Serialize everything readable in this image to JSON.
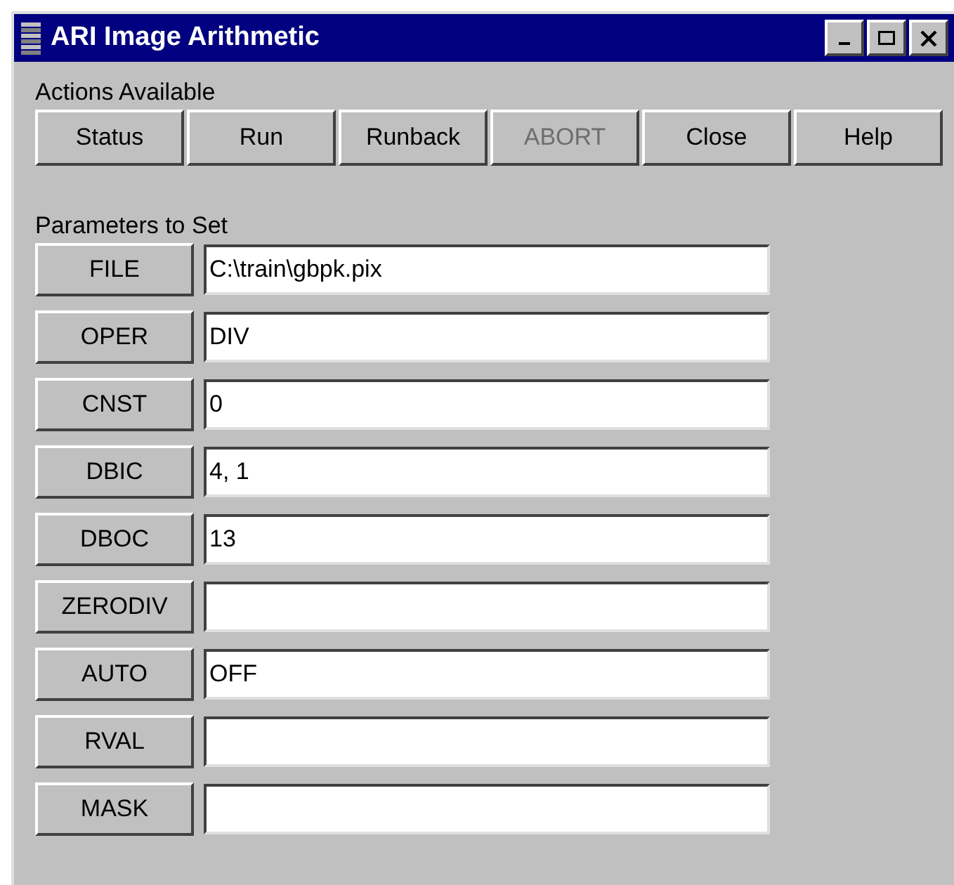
{
  "window": {
    "title": "ARI Image Arithmetic"
  },
  "actions": {
    "label": "Actions Available",
    "buttons": [
      {
        "label": "Status",
        "disabled": false
      },
      {
        "label": "Run",
        "disabled": false
      },
      {
        "label": "Runback",
        "disabled": false
      },
      {
        "label": "ABORT",
        "disabled": true
      },
      {
        "label": "Close",
        "disabled": false
      },
      {
        "label": "Help",
        "disabled": false
      }
    ]
  },
  "parameters": {
    "label": "Parameters to Set",
    "rows": [
      {
        "name": "FILE",
        "value": "C:\\train\\gbpk.pix"
      },
      {
        "name": "OPER",
        "value": "DIV"
      },
      {
        "name": "CNST",
        "value": "0"
      },
      {
        "name": "DBIC",
        "value": "4, 1"
      },
      {
        "name": "DBOC",
        "value": "13"
      },
      {
        "name": "ZERODIV"
      },
      {
        "name": "AUTO",
        "value": "OFF"
      },
      {
        "name": "RVAL"
      },
      {
        "name": "MASK"
      }
    ]
  }
}
